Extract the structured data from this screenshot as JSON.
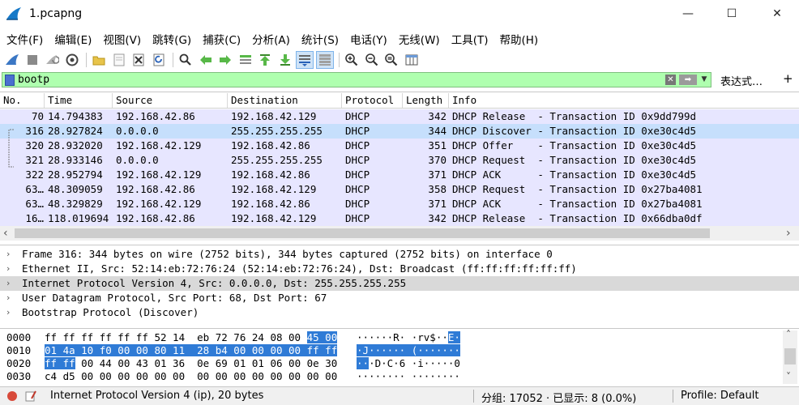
{
  "window": {
    "title": "1.pcapng",
    "minimize": "—",
    "maximize": "☐",
    "close": "✕"
  },
  "menu": [
    "文件(F)",
    "编辑(E)",
    "视图(V)",
    "跳转(G)",
    "捕获(C)",
    "分析(A)",
    "统计(S)",
    "电话(Y)",
    "无线(W)",
    "工具(T)",
    "帮助(H)"
  ],
  "filter": {
    "value": "bootp",
    "clear": "✕",
    "apply": "➡",
    "dropdown": "▼",
    "expression": "表达式…",
    "add": "+"
  },
  "packet_list": {
    "columns": [
      "No.",
      "Time",
      "Source",
      "Destination",
      "Protocol",
      "Length",
      "Info"
    ],
    "rows": [
      {
        "no": "70",
        "time": "14.794383",
        "src": "192.168.42.86",
        "dst": "192.168.42.129",
        "proto": "DHCP",
        "len": "342",
        "info": "DHCP Release  - Transaction ID 0x9dd799d"
      },
      {
        "no": "316",
        "time": "28.927824",
        "src": "0.0.0.0",
        "dst": "255.255.255.255",
        "proto": "DHCP",
        "len": "344",
        "info": "DHCP Discover - Transaction ID 0xe30c4d5"
      },
      {
        "no": "320",
        "time": "28.932020",
        "src": "192.168.42.129",
        "dst": "192.168.42.86",
        "proto": "DHCP",
        "len": "351",
        "info": "DHCP Offer    - Transaction ID 0xe30c4d5"
      },
      {
        "no": "321",
        "time": "28.933146",
        "src": "0.0.0.0",
        "dst": "255.255.255.255",
        "proto": "DHCP",
        "len": "370",
        "info": "DHCP Request  - Transaction ID 0xe30c4d5"
      },
      {
        "no": "322",
        "time": "28.952794",
        "src": "192.168.42.129",
        "dst": "192.168.42.86",
        "proto": "DHCP",
        "len": "371",
        "info": "DHCP ACK      - Transaction ID 0xe30c4d5"
      },
      {
        "no": "63…",
        "time": "48.309059",
        "src": "192.168.42.86",
        "dst": "192.168.42.129",
        "proto": "DHCP",
        "len": "358",
        "info": "DHCP Request  - Transaction ID 0x27ba4081"
      },
      {
        "no": "63…",
        "time": "48.329829",
        "src": "192.168.42.129",
        "dst": "192.168.42.86",
        "proto": "DHCP",
        "len": "371",
        "info": "DHCP ACK      - Transaction ID 0x27ba4081"
      },
      {
        "no": "16…",
        "time": "118.019694",
        "src": "192.168.42.86",
        "dst": "192.168.42.129",
        "proto": "DHCP",
        "len": "342",
        "info": "DHCP Release  - Transaction ID 0x66dba0df"
      }
    ],
    "selected_index": 1,
    "scroll_left": "‹",
    "scroll_right": "›"
  },
  "details": [
    "Frame 316: 344 bytes on wire (2752 bits), 344 bytes captured (2752 bits) on interface 0",
    "Ethernet II, Src: 52:14:eb:72:76:24 (52:14:eb:72:76:24), Dst: Broadcast (ff:ff:ff:ff:ff:ff)",
    "Internet Protocol Version 4, Src: 0.0.0.0, Dst: 255.255.255.255",
    "User Datagram Protocol, Src Port: 68, Dst Port: 67",
    "Bootstrap Protocol (Discover)"
  ],
  "detail_chevron": "›",
  "bytes": {
    "offsets": [
      "0000",
      "0010",
      "0020",
      "0030"
    ],
    "rows": [
      {
        "pre": "ff ff ff ff ff ff 52 14  eb 72 76 24 08 00 ",
        "hl": "45 00",
        "post": "",
        "ascii_pre": "······R· ·rv$··",
        "ascii_hl": "E·",
        "ascii_post": ""
      },
      {
        "pre": "",
        "hl": "01 4a 10 f0 00 00 80 11  28 b4 00 00 00 00 ff ff",
        "post": "",
        "ascii_pre": "",
        "ascii_hl": "·J······ (·······",
        "ascii_post": ""
      },
      {
        "pre": "",
        "hl": "ff ff",
        "post": " 00 44 00 43 01 36  0e 69 01 01 06 00 0e 30",
        "ascii_pre": "",
        "ascii_hl": "··",
        "ascii_post": "·D·C·6 ·i·····0"
      },
      {
        "pre": "c4 d5 00 00 00 00 00 00  00 00 00 00 00 00 00 00",
        "hl": "",
        "post": "",
        "ascii_pre": "········ ········",
        "ascii_hl": "",
        "ascii_post": ""
      }
    ],
    "scroll_up": "˄",
    "scroll_down": "˅"
  },
  "status": {
    "field": "Internet Protocol Version 4 (ip), 20 bytes",
    "packets": "分组: 17052 · 已显示: 8 (0.0%)",
    "profile": "Profile: Default"
  },
  "colors": {
    "row_bg": "#e7e6ff",
    "row_selected": "#c6dffc",
    "filter_ok": "#afffaf",
    "bytes_highlight": "#2f7bd6"
  }
}
